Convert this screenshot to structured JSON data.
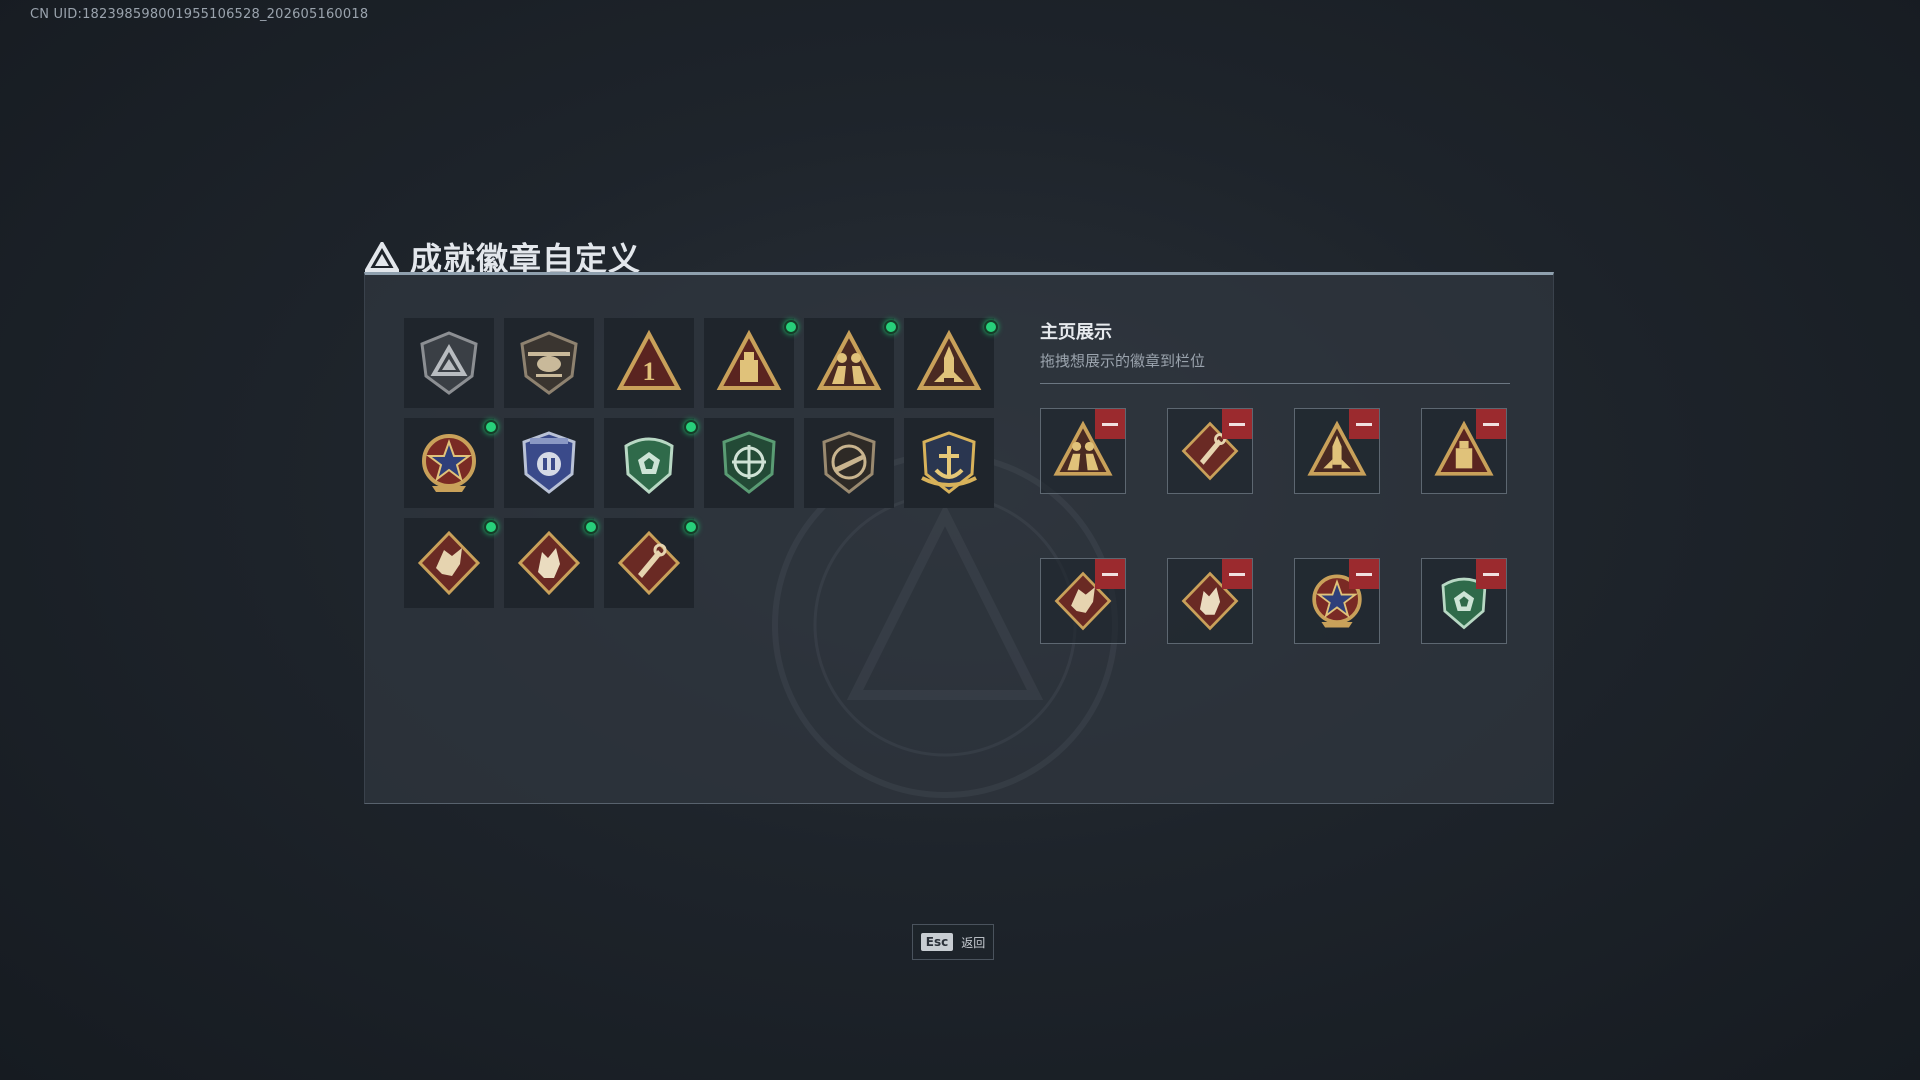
{
  "uid_text": "CN UID:182398598001955106528_202605160018",
  "window": {
    "title": "成就徽章自定义"
  },
  "badges": [
    {
      "icon": "shield-triangle-icon",
      "new": false
    },
    {
      "icon": "helicopter-shield-icon",
      "new": false
    },
    {
      "icon": "rank-one-triangle-icon",
      "new": false
    },
    {
      "icon": "triangle-tower-icon",
      "new": true
    },
    {
      "icon": "triangle-soldiers-icon",
      "new": true
    },
    {
      "icon": "triangle-rocket-icon",
      "new": true
    },
    {
      "icon": "star-medal-icon",
      "new": true
    },
    {
      "icon": "blue-police-shield-icon",
      "new": false
    },
    {
      "icon": "green-helmet-shield-icon",
      "new": true
    },
    {
      "icon": "green-crosshair-shield-icon",
      "new": false
    },
    {
      "icon": "rifle-shield-icon",
      "new": false
    },
    {
      "icon": "gold-anchor-shield-icon",
      "new": false
    },
    {
      "icon": "dragon-diamond-icon",
      "new": true
    },
    {
      "icon": "wolf-diamond-icon",
      "new": true
    },
    {
      "icon": "tool-diamond-icon",
      "new": true
    }
  ],
  "showcase": {
    "title": "主页展示",
    "subtitle": "拖拽想展示的徽章到栏位",
    "slots": [
      {
        "icon": "triangle-soldiers-icon"
      },
      {
        "icon": "tool-diamond-icon"
      },
      {
        "icon": "triangle-rocket-icon"
      },
      {
        "icon": "triangle-tower-icon"
      },
      {
        "icon": "dragon-diamond-icon"
      },
      {
        "icon": "wolf-diamond-icon"
      },
      {
        "icon": "star-medal-icon"
      },
      {
        "icon": "green-helmet-shield-icon"
      }
    ]
  },
  "footer": {
    "esc_key": "Esc",
    "back_label": "返回"
  },
  "colors": {
    "accent_green": "#27d07a",
    "remove_red": "#9b2a2e",
    "gold": "#c9a15a"
  }
}
